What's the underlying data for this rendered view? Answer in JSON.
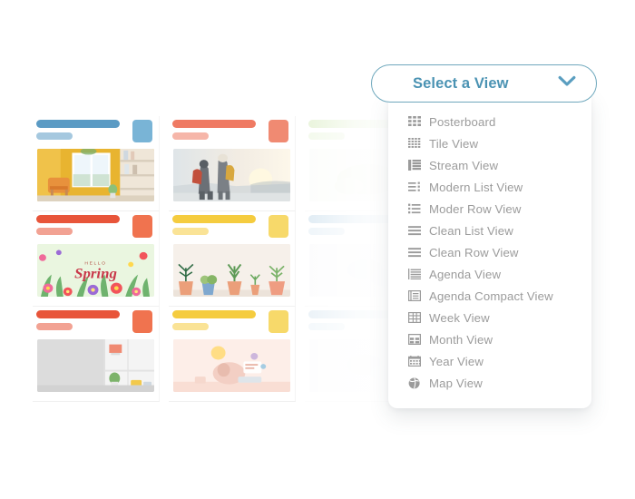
{
  "select_control": {
    "label": "Select a View",
    "icon": "chevron-down-icon",
    "border_color": "#6fa8bd",
    "text_color": "#4b93b3"
  },
  "dropdown": {
    "text_color": "#9b9b9b",
    "items": [
      {
        "label": "Posterboard",
        "icon": "grid-large-icon"
      },
      {
        "label": "Tile View",
        "icon": "grid-small-icon"
      },
      {
        "label": "Stream View",
        "icon": "stream-list-icon"
      },
      {
        "label": "Modern List View",
        "icon": "modern-list-icon"
      },
      {
        "label": "Moder Row View",
        "icon": "bullet-list-icon"
      },
      {
        "label": "Clean List View",
        "icon": "lines-icon"
      },
      {
        "label": "Clean Row View",
        "icon": "lines-icon"
      },
      {
        "label": "Agenda View",
        "icon": "agenda-icon"
      },
      {
        "label": "Agenda Compact View",
        "icon": "agenda-compact-icon"
      },
      {
        "label": "Week View",
        "icon": "table-week-icon"
      },
      {
        "label": "Month View",
        "icon": "table-month-icon"
      },
      {
        "label": "Year View",
        "icon": "calendar-icon"
      },
      {
        "label": "Map View",
        "icon": "globe-icon"
      }
    ]
  },
  "cards": [
    {
      "name": "yellow-room-card",
      "accent": "#5b9bc4",
      "badge": "#79b4d6",
      "thumb": "yellow-room-photo",
      "faded": "none"
    },
    {
      "name": "hikers-card",
      "accent": "#ef7a63",
      "badge": "#f08a72",
      "thumb": "hikers-sunset-photo",
      "faded": "none"
    },
    {
      "name": "green-faded-card",
      "accent": "#8cc63f",
      "badge": "#a8d96a",
      "thumb": "green-faded-thumb",
      "faded": "light"
    },
    {
      "name": "spring-card",
      "accent": "#e8553a",
      "badge": "#f0734f",
      "thumb": "hello-spring-poster",
      "faded": "none"
    },
    {
      "name": "plants-card",
      "accent": "#f5cc3f",
      "badge": "#f7d96a",
      "thumb": "potted-plants-photo",
      "faded": "none"
    },
    {
      "name": "blue-faded-card",
      "accent": "#5b9bc4",
      "badge": "#9cc8e0",
      "thumb": "blue-faded-thumb",
      "faded": "light"
    },
    {
      "name": "shelf-card",
      "accent": "#e8553a",
      "badge": "#f0734f",
      "thumb": "grey-shelf-photo",
      "faded": "none"
    },
    {
      "name": "desk-card",
      "accent": "#f5cc3f",
      "badge": "#f7d96a",
      "thumb": "pink-desk-photo",
      "faded": "none"
    },
    {
      "name": "blue-faded-card-2",
      "accent": "#5b9bc4",
      "badge": "#9cc8e0",
      "thumb": "blue-faded-thumb",
      "faded": "lighter"
    }
  ],
  "spring_poster": {
    "small_text": "HELLO",
    "big_text": "Spring"
  }
}
